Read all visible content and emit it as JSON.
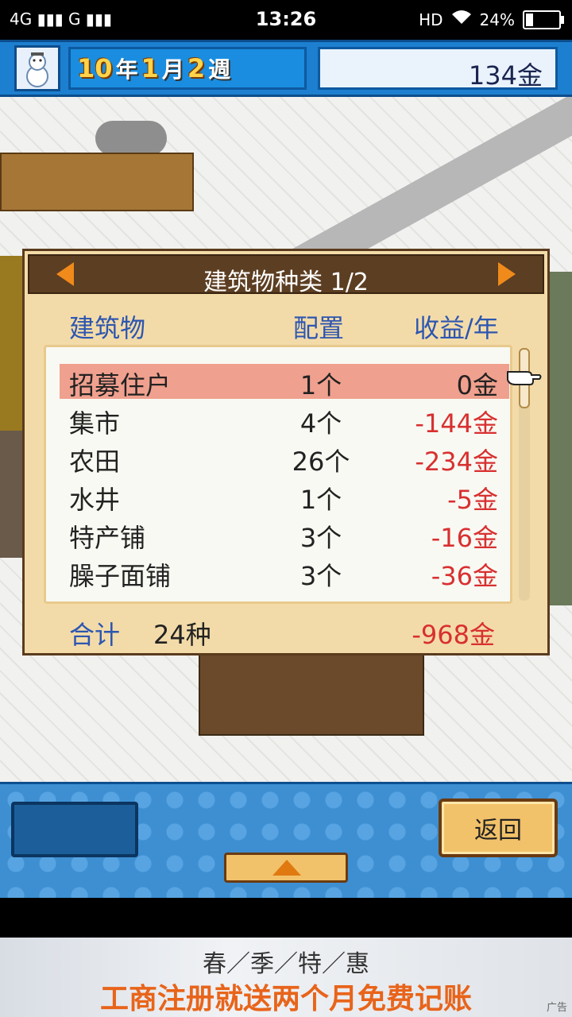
{
  "status_bar": {
    "signal": "4G ▮▮▮ G ▮▮▮",
    "time": "13:26",
    "hd": "HD",
    "battery": "24%",
    "battery_level": 0.24
  },
  "top_bar": {
    "year": "10",
    "year_unit": "年",
    "month": "1",
    "month_unit": "月",
    "week": "2",
    "week_unit": "週",
    "gold": "134金"
  },
  "panel": {
    "title": "建筑物种类 1/2",
    "col_building": "建筑物",
    "col_count": "配置",
    "col_income": "收益/年",
    "rows": [
      {
        "name": "招募住户",
        "count": "1个",
        "income": "0金"
      },
      {
        "name": "集市",
        "count": "4个",
        "income": "-144金"
      },
      {
        "name": "农田",
        "count": "26个",
        "income": "-234金"
      },
      {
        "name": "水井",
        "count": "1个",
        "income": "-5金"
      },
      {
        "name": "特产铺",
        "count": "3个",
        "income": "-16金"
      },
      {
        "name": "臊子面铺",
        "count": "3个",
        "income": "-36金"
      }
    ],
    "total_label": "合计",
    "total_kinds": "24种",
    "total_income": "-968金"
  },
  "bottom_bar": {
    "back_label": "返回"
  },
  "ad": {
    "line1": "春／季／特／惠",
    "line2": "工商注册就送两个月免费记账",
    "tag": "广告"
  },
  "colors": {
    "accent_blue": "#1d7fcf",
    "panel_bg": "#f3dba9",
    "negative": "#d83030",
    "selected_row": "#f0a08e"
  }
}
